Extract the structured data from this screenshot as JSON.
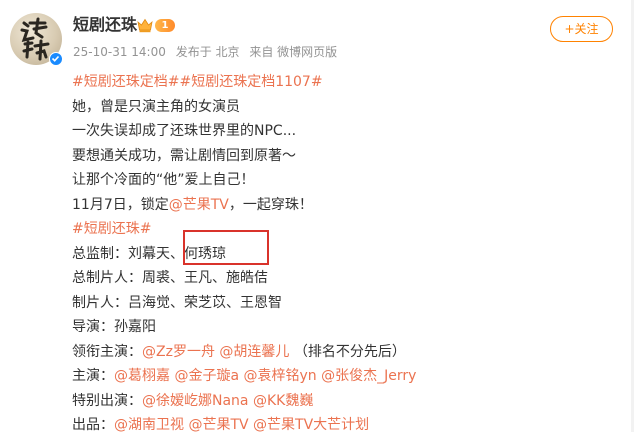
{
  "post": {
    "username": "短剧还珠",
    "level": "1",
    "timestamp": "25-10-31 14:00",
    "publish_location": "发布于 北京",
    "source": "来自 微博网页版",
    "follow_label": "+关注",
    "avatar_text": "还珠",
    "accent_color": "#eb7350",
    "highlight_color": "#d9332b",
    "content": {
      "line1": {
        "tag1": "#短剧还珠定档#",
        "tag2": "#短剧还珠定档1107#"
      },
      "line2": "她，曾是只演主角的女演员",
      "line3": "一次失误却成了还珠世界里的NPC...",
      "line4": "要想通关成功，需让剧情回到原著～",
      "line5": "让那个冷面的“他”爱上自己！",
      "line6": {
        "prefix": "11月7日，锁定",
        "mention": "@芒果TV",
        "suffix": "，一起穿珠！"
      },
      "line7": {
        "tag": "#短剧还珠#"
      },
      "line8": {
        "label": "总监制：",
        "names": "刘幕天、",
        "highlighted_name": "何琇琼"
      },
      "line9": {
        "label": "总制片人：",
        "names": "周裘、王凡、施皓佶"
      },
      "line10": {
        "label": "制片人：",
        "names": "吕海觉、荣芝苡、王恩智"
      },
      "line11": {
        "label": "导演：",
        "names": "孙嘉阳"
      },
      "line12": {
        "label": "领衔主演：",
        "mention1": "@Zz罗一舟",
        "mention2": "@胡连馨儿",
        "note": "（排名不分先后）"
      },
      "line13": {
        "label": "主演：",
        "mention1": "@葛栩嘉",
        "mention2": "@金子璇a",
        "mention3": "@袁梓铭yn",
        "mention4": "@张俊杰_Jerry"
      },
      "line14": {
        "label": "特别出演：",
        "mention1": "@徐嫒屹娜Nana",
        "mention2": "@KK魏巍"
      },
      "line15": {
        "label": "出品：",
        "mention1": "@湖南卫视",
        "mention2": "@芒果TV",
        "mention3": "@芒果TV大芒计划"
      }
    }
  }
}
